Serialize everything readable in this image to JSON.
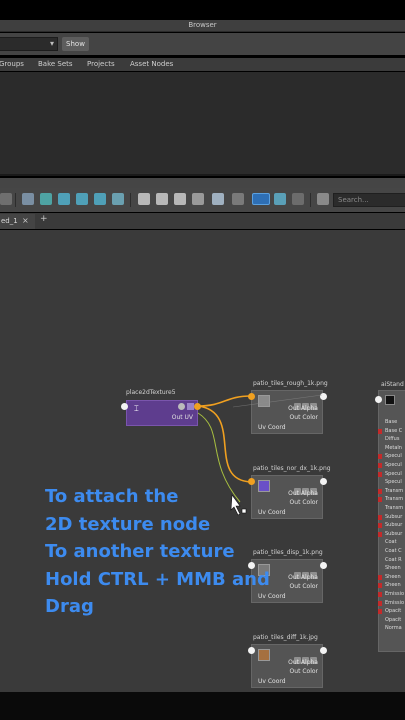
{
  "browser": {
    "title": "Browser",
    "show_label": "Show",
    "tabs": [
      "Groups",
      "Bake Sets",
      "Projects",
      "Asset Nodes"
    ]
  },
  "toolbar": {
    "search_placeholder": "Search..."
  },
  "graph_tab": {
    "label": "ed_1",
    "close": "×",
    "add": "+"
  },
  "nodes": {
    "place2d": {
      "title": "place2dTexture5",
      "out_label": "Out UV"
    },
    "rough": {
      "title": "patio_tiles_rough_1k.png",
      "outs": [
        "Out Alpha",
        "Out Color"
      ],
      "uv": "Uv Coord",
      "swatch": "#8a8a8a"
    },
    "nor": {
      "title": "patio_tiles_nor_dx_1k.png",
      "outs": [
        "Out Alpha",
        "Out Color"
      ],
      "uv": "Uv Coord",
      "swatch": "#6a50c8"
    },
    "disp": {
      "title": "patio_tiles_disp_1k.png",
      "outs": [
        "Out Alpha",
        "Out Color"
      ],
      "uv": "Uv Coord",
      "swatch": "#7a7a7a"
    },
    "diff": {
      "title": "patio_tiles_diff_1k.jpg",
      "outs": [
        "Out Alpha",
        "Out Color"
      ],
      "uv": "Uv Coord",
      "swatch": "#a57040"
    },
    "standard": {
      "title": "aiStand",
      "rows": [
        "Base",
        "Base C",
        "Diffus",
        "Metaln",
        "Specul",
        "Specul",
        "Specul",
        "Specul",
        "Transm",
        "Transm",
        "Transm",
        "Subsur",
        "Subsur",
        "Subsur",
        "Coat",
        "Coat C",
        "Coat R",
        "Sheen",
        "Sheen",
        "Sheen",
        "Emissio",
        "Emissio",
        "Opacit",
        "Opacit",
        "Norma"
      ]
    }
  },
  "caption": {
    "lines": [
      "To attach the",
      "2D texture node",
      "To another texture",
      "Hold CTRL + MMB and",
      "Drag"
    ]
  },
  "colors": {
    "caption": "#3d8bef",
    "place_node": "#5e3d8e",
    "wire_active": "#f0a020",
    "wire_pending": "#a8c040"
  }
}
